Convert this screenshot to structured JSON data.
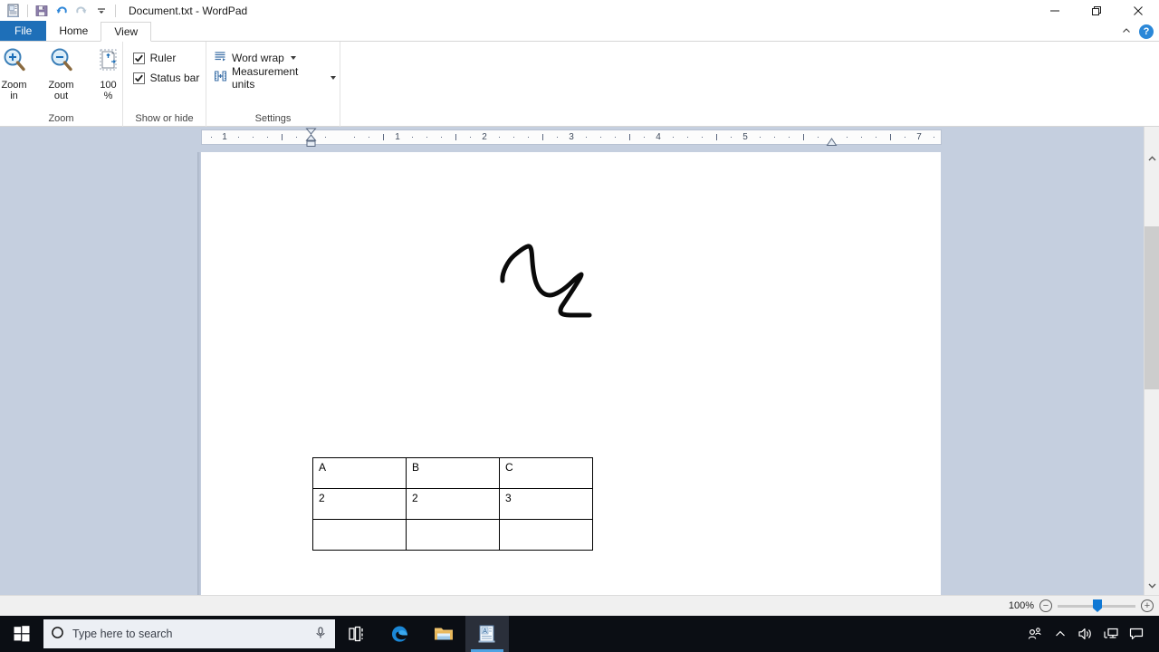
{
  "window": {
    "title": "Document.txt - WordPad",
    "app_icon": "wordpad-icon",
    "quick_access": [
      {
        "name": "save-icon",
        "label": "Save"
      },
      {
        "name": "undo-icon",
        "label": "Undo"
      },
      {
        "name": "redo-icon",
        "label": "Redo"
      },
      {
        "name": "customize-quick-access-icon",
        "label": "Customize Quick Access Toolbar"
      }
    ],
    "controls": {
      "minimize": "Minimize",
      "restore": "Restore Down",
      "close": "Close",
      "collapse_ribbon": "Collapse the Ribbon",
      "help": "?"
    }
  },
  "tabs": [
    {
      "label": "File",
      "active": false,
      "kind": "file"
    },
    {
      "label": "Home",
      "active": false,
      "kind": "normal"
    },
    {
      "label": "View",
      "active": true,
      "kind": "normal"
    }
  ],
  "ribbon": {
    "groups": [
      {
        "label": "Zoom",
        "buttons": [
          {
            "name": "zoom-in-button",
            "line1": "Zoom",
            "line2": "in",
            "icon": "magnifier-plus-icon"
          },
          {
            "name": "zoom-out-button",
            "line1": "Zoom",
            "line2": "out",
            "icon": "magnifier-minus-icon"
          },
          {
            "name": "zoom-100-button",
            "line1": "100",
            "line2": "%",
            "icon": "page-100-icon"
          }
        ]
      },
      {
        "label": "Show or hide",
        "checkboxes": [
          {
            "name": "ruler-checkbox",
            "label": "Ruler",
            "checked": true
          },
          {
            "name": "status-bar-checkbox",
            "label": "Status bar",
            "checked": true
          }
        ]
      },
      {
        "label": "Settings",
        "menus": [
          {
            "name": "word-wrap-menu",
            "label": "Word wrap",
            "icon": "word-wrap-icon"
          },
          {
            "name": "measurement-units-menu",
            "label": "Measurement units",
            "icon": "measurement-units-icon"
          }
        ]
      }
    ]
  },
  "ruler": {
    "numbers": [
      "1",
      "1",
      "2",
      "3",
      "4",
      "5",
      "7"
    ],
    "left_indent_marker": "left-indent-marker",
    "right_indent_marker": "right-indent-marker"
  },
  "document": {
    "ink_annotation": "freehand-scribble",
    "table": {
      "rows": [
        [
          "A",
          "B",
          "C"
        ],
        [
          "2",
          "2",
          "3"
        ],
        [
          "",
          "",
          ""
        ]
      ]
    }
  },
  "status_bar": {
    "zoom_level": "100%",
    "zoom_out_label": "−",
    "zoom_in_label": "+"
  },
  "taskbar": {
    "start": "start-button",
    "search_placeholder": "Type here to search",
    "items": [
      {
        "name": "task-view-icon",
        "label": "Task View"
      },
      {
        "name": "microsoft-edge-icon",
        "label": "Microsoft Edge"
      },
      {
        "name": "file-explorer-icon",
        "label": "File Explorer"
      },
      {
        "name": "wordpad-taskbar-icon",
        "label": "WordPad",
        "active": true
      }
    ],
    "tray": [
      {
        "name": "people-icon",
        "label": "People"
      },
      {
        "name": "show-hidden-icons-icon",
        "label": "Show hidden icons"
      },
      {
        "name": "volume-icon",
        "label": "Speakers"
      },
      {
        "name": "network-icon",
        "label": "Network"
      },
      {
        "name": "action-center-icon",
        "label": "Notifications"
      }
    ]
  },
  "colors": {
    "accent": "#1e6fb8",
    "workspace": "#c5cfdf",
    "taskbar": "#0b0e14",
    "slider": "#0f78d4"
  }
}
